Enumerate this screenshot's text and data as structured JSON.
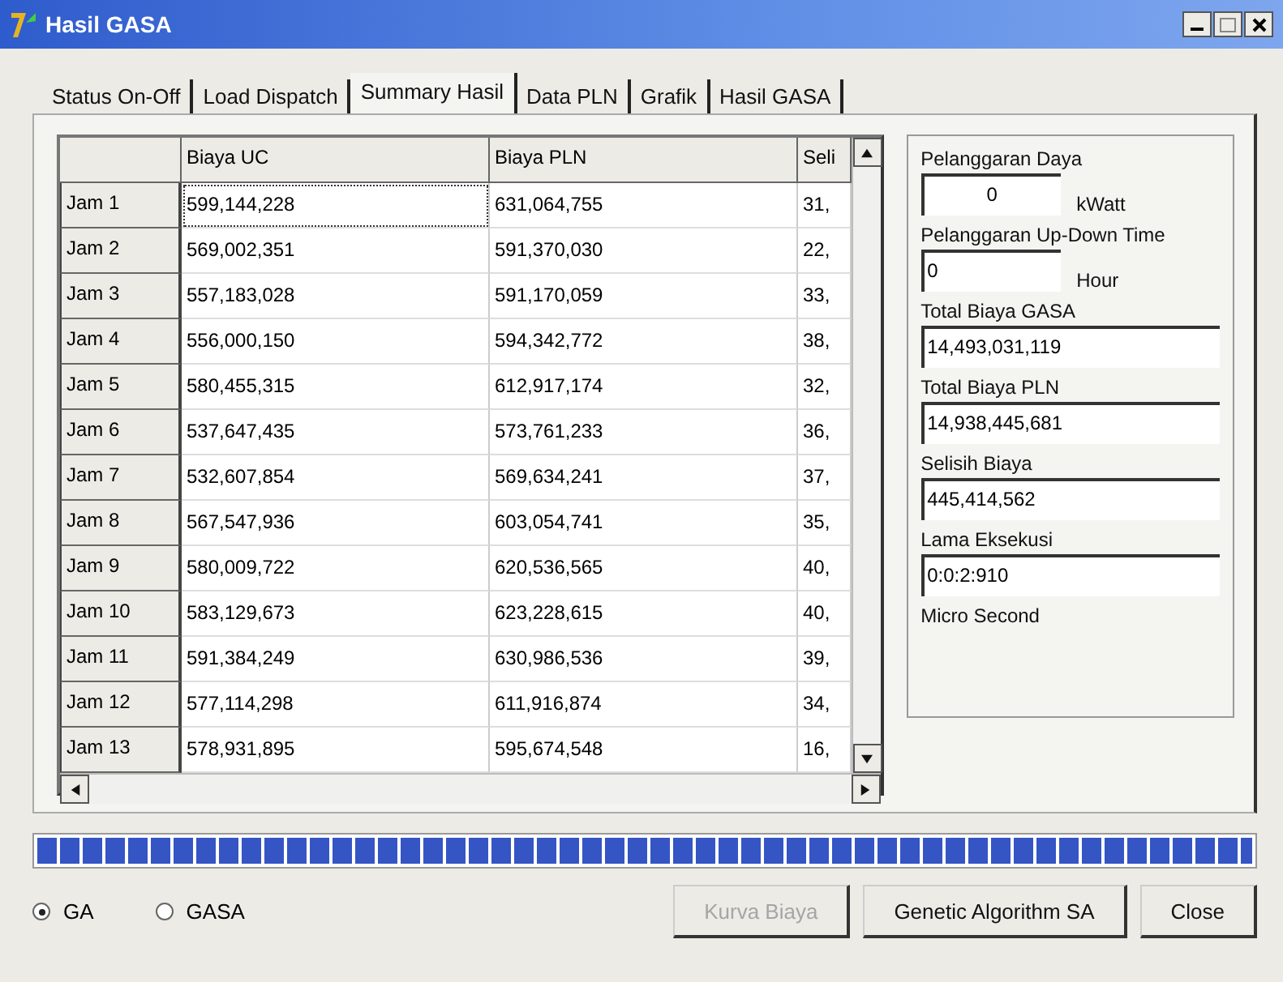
{
  "window": {
    "title": "Hasil GASA"
  },
  "tabs": [
    {
      "label": "Status On-Off",
      "selected": false
    },
    {
      "label": "Load Dispatch",
      "selected": false
    },
    {
      "label": "Summary Hasil",
      "selected": true
    },
    {
      "label": "Data PLN",
      "selected": false
    },
    {
      "label": "Grafik",
      "selected": false
    },
    {
      "label": "Hasil GASA",
      "selected": false
    }
  ],
  "table": {
    "columns": [
      "Biaya UC",
      "Biaya PLN",
      "Seli"
    ],
    "rows": [
      {
        "label": "Jam 1",
        "cells": [
          "599,144,228",
          "631,064,755",
          "31,"
        ],
        "focused_cell": true
      },
      {
        "label": "Jam 2",
        "cells": [
          "569,002,351",
          "591,370,030",
          "22,"
        ],
        "focused_cell": false
      },
      {
        "label": "Jam 3",
        "cells": [
          "557,183,028",
          "591,170,059",
          "33,"
        ],
        "focused_cell": false
      },
      {
        "label": "Jam 4",
        "cells": [
          "556,000,150",
          "594,342,772",
          "38,"
        ],
        "focused_cell": false
      },
      {
        "label": "Jam 5",
        "cells": [
          "580,455,315",
          "612,917,174",
          "32,"
        ],
        "focused_cell": false
      },
      {
        "label": "Jam 6",
        "cells": [
          "537,647,435",
          "573,761,233",
          "36,"
        ],
        "focused_cell": false
      },
      {
        "label": "Jam 7",
        "cells": [
          "532,607,854",
          "569,634,241",
          "37,"
        ],
        "focused_cell": false
      },
      {
        "label": "Jam 8",
        "cells": [
          "567,547,936",
          "603,054,741",
          "35,"
        ],
        "focused_cell": false
      },
      {
        "label": "Jam 9",
        "cells": [
          "580,009,722",
          "620,536,565",
          "40,"
        ],
        "focused_cell": false
      },
      {
        "label": "Jam 10",
        "cells": [
          "583,129,673",
          "623,228,615",
          "40,"
        ],
        "focused_cell": false
      },
      {
        "label": "Jam 11",
        "cells": [
          "591,384,249",
          "630,986,536",
          "39,"
        ],
        "focused_cell": false
      },
      {
        "label": "Jam 12",
        "cells": [
          "577,114,298",
          "611,916,874",
          "34,"
        ],
        "focused_cell": false
      },
      {
        "label": "Jam 13",
        "cells": [
          "578,931,895",
          "595,674,548",
          "16,"
        ],
        "focused_cell": false
      }
    ]
  },
  "summary": [
    {
      "kind": "unit",
      "label": "Pelanggaran Daya",
      "value": "0",
      "unit": "kWatt",
      "centered": true
    },
    {
      "kind": "unit",
      "label": "Pelanggaran Up-Down Time",
      "value": "0",
      "unit": "Hour",
      "centered": false
    },
    {
      "kind": "field",
      "label": "Total Biaya GASA",
      "value": "14,493,031,119"
    },
    {
      "kind": "field",
      "label": "Total Biaya PLN",
      "value": "14,938,445,681"
    },
    {
      "kind": "field",
      "label": "Selisih Biaya",
      "value": "445,414,562"
    },
    {
      "kind": "field",
      "label": "Lama Eksekusi",
      "value": "0:0:2:910"
    },
    {
      "kind": "note",
      "label": "Micro Second"
    }
  ],
  "progress": {
    "level": 1
  },
  "radios": [
    {
      "label": "GA",
      "selected": true
    },
    {
      "label": "GASA",
      "selected": false
    }
  ],
  "buttons": [
    {
      "label": "Kurva Biaya",
      "disabled": true
    },
    {
      "label": "Genetic Algorithm SA",
      "disabled": false
    },
    {
      "label": "Close",
      "disabled": false
    }
  ]
}
